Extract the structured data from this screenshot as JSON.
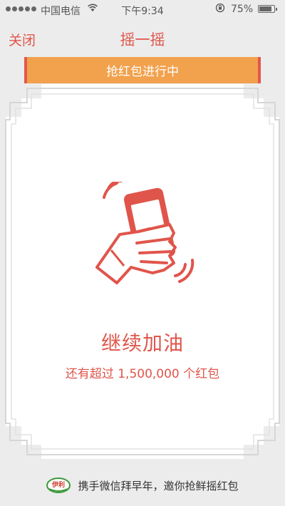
{
  "status_bar": {
    "carrier": "中国电信",
    "time": "下午9:34",
    "battery": "75%"
  },
  "nav": {
    "close_label": "关闭",
    "title": "摇一摇"
  },
  "banner": {
    "label": "抢红包进行中"
  },
  "main": {
    "headline": "继续加油",
    "subline": "还有超过 1,500,000 个红包"
  },
  "footer": {
    "brand_text": "伊利",
    "text": "携手微信拜早年，邀你抢鲜摇红包"
  },
  "colors": {
    "accent": "#e0554b",
    "banner": "#f2a14d",
    "background": "#ececec"
  }
}
